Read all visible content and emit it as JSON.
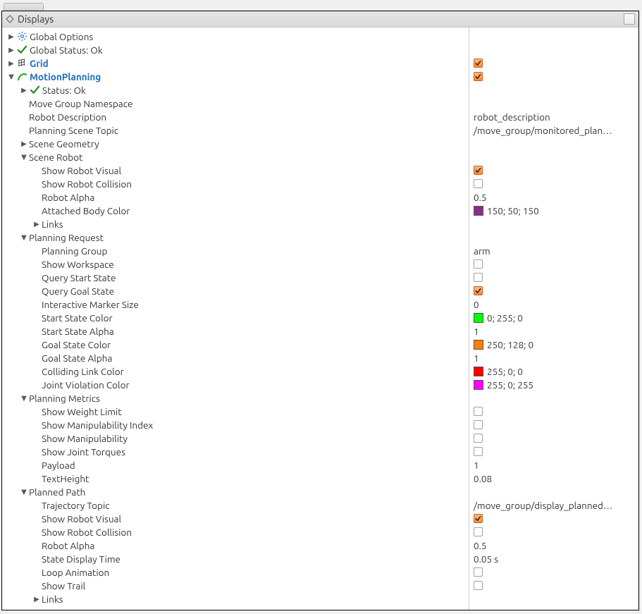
{
  "panel": {
    "title": "Displays"
  },
  "tree": {
    "global_options": {
      "label": "Global Options"
    },
    "global_status": {
      "label": "Global Status: Ok"
    },
    "grid": {
      "label": "Grid"
    },
    "motion_planning": {
      "label": "MotionPlanning"
    },
    "status_ok": {
      "label": "Status: Ok"
    },
    "move_group_ns": {
      "label": "Move Group Namespace"
    },
    "robot_description": {
      "label": "Robot Description"
    },
    "planning_scene_topic": {
      "label": "Planning Scene Topic"
    },
    "scene_geometry": {
      "label": "Scene Geometry"
    },
    "scene_robot": {
      "label": "Scene Robot"
    },
    "show_robot_visual": {
      "label": "Show Robot Visual"
    },
    "show_robot_collision": {
      "label": "Show Robot Collision"
    },
    "robot_alpha": {
      "label": "Robot Alpha"
    },
    "attached_body_color": {
      "label": "Attached Body Color"
    },
    "links": {
      "label": "Links"
    },
    "planning_request": {
      "label": "Planning Request"
    },
    "planning_group": {
      "label": "Planning Group"
    },
    "show_workspace": {
      "label": "Show Workspace"
    },
    "query_start_state": {
      "label": "Query Start State"
    },
    "query_goal_state": {
      "label": "Query Goal State"
    },
    "interactive_marker_size": {
      "label": "Interactive Marker Size"
    },
    "start_state_color": {
      "label": "Start State Color"
    },
    "start_state_alpha": {
      "label": "Start State Alpha"
    },
    "goal_state_color": {
      "label": "Goal State Color"
    },
    "goal_state_alpha": {
      "label": "Goal State Alpha"
    },
    "colliding_link_color": {
      "label": "Colliding Link Color"
    },
    "joint_violation_color": {
      "label": "Joint Violation Color"
    },
    "planning_metrics": {
      "label": "Planning Metrics"
    },
    "show_weight_limit": {
      "label": "Show Weight Limit"
    },
    "show_manip_index": {
      "label": "Show Manipulability Index"
    },
    "show_manip": {
      "label": "Show Manipulability"
    },
    "show_joint_torques": {
      "label": "Show Joint Torques"
    },
    "payload": {
      "label": "Payload"
    },
    "text_height": {
      "label": "TextHeight"
    },
    "planned_path": {
      "label": "Planned Path"
    },
    "trajectory_topic": {
      "label": "Trajectory Topic"
    },
    "pp_show_robot_visual": {
      "label": "Show Robot Visual"
    },
    "pp_show_robot_collision": {
      "label": "Show Robot Collision"
    },
    "pp_robot_alpha": {
      "label": "Robot Alpha"
    },
    "state_display_time": {
      "label": "State Display Time"
    },
    "loop_animation": {
      "label": "Loop Animation"
    },
    "show_trail": {
      "label": "Show Trail"
    },
    "pp_links": {
      "label": "Links"
    }
  },
  "values": {
    "robot_description": "robot_description",
    "planning_scene_topic": "/move_group/monitored_plan…",
    "robot_alpha": "0.5",
    "attached_body_color": "150; 50; 150",
    "planning_group": "arm",
    "interactive_marker_size": "0",
    "start_state_color": "0; 255; 0",
    "start_state_alpha": "1",
    "goal_state_color": "250; 128; 0",
    "goal_state_alpha": "1",
    "colliding_link_color": "255; 0; 0",
    "joint_violation_color": "255; 0; 255",
    "payload": "1",
    "text_height": "0.08",
    "trajectory_topic": "/move_group/display_planned…",
    "pp_robot_alpha": "0.5",
    "state_display_time": "0.05 s"
  },
  "colors": {
    "attached_body_color": "#8a2d8a",
    "start_state_color": "#00ff00",
    "goal_state_color": "#fa8000",
    "colliding_link_color": "#ff0000",
    "joint_violation_color": "#ff00ff"
  }
}
